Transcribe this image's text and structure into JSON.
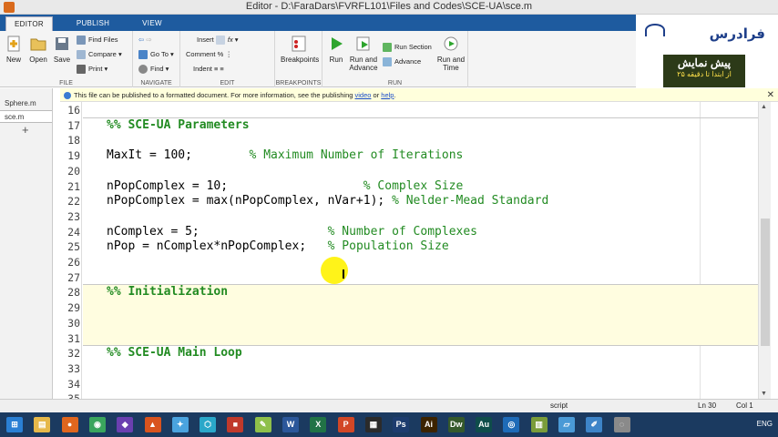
{
  "window": {
    "title": "Editor - D:\\FaraDars\\FVRFL101\\Files and Codes\\SCE-UA\\sce.m"
  },
  "tabs": [
    {
      "label": "EDITOR"
    },
    {
      "label": "PUBLISH"
    },
    {
      "label": "VIEW"
    }
  ],
  "ribbon": {
    "file": {
      "new": "New",
      "open": "Open",
      "save": "Save",
      "find_files": "Find Files",
      "compare": "Compare",
      "print": "Print",
      "group": "FILE"
    },
    "navigate": {
      "go_to": "Go To",
      "find": "Find",
      "group": "NAVIGATE"
    },
    "edit": {
      "insert": "Insert",
      "comment": "Comment",
      "indent": "Indent",
      "fx": "fx",
      "group": "EDIT"
    },
    "breakpoints": {
      "breakpoints": "Breakpoints",
      "group": "BREAKPOINTS"
    },
    "run": {
      "run": "Run",
      "run_advance": "Run and Advance",
      "run_section": "Run Section",
      "advance": "Advance",
      "run_time": "Run and Time",
      "group": "RUN"
    }
  },
  "logo": {
    "brand": "فرادرس",
    "promo_line1": "پیش نمایش",
    "promo_line2": "از ابتدا تا دقیقه ۲۵"
  },
  "infobar": {
    "text": "This file can be published to a formatted document. For more information, see the publishing ",
    "link1": "video",
    "mid": " or ",
    "link2": "help",
    "end": "."
  },
  "files": [
    {
      "label": "Sphere.m"
    },
    {
      "label": "sce.m"
    }
  ],
  "editor": {
    "lines": [
      {
        "n": "16",
        "code": "",
        "comment": ""
      },
      {
        "n": "17",
        "code": "",
        "comment": "%% SCE-UA Parameters",
        "cell": true
      },
      {
        "n": "18",
        "code": "",
        "comment": ""
      },
      {
        "n": "19",
        "code": "MaxIt = 100;        ",
        "comment": "% Maximum Number of Iterations"
      },
      {
        "n": "20",
        "code": "",
        "comment": ""
      },
      {
        "n": "21",
        "code": "nPopComplex = 10;                   ",
        "comment": "% Complex Size"
      },
      {
        "n": "22",
        "code": "nPopComplex = max(nPopComplex, nVar+1); ",
        "comment": "% Nelder-Mead Standard"
      },
      {
        "n": "23",
        "code": "",
        "comment": ""
      },
      {
        "n": "24",
        "code": "nComplex = 5;                  ",
        "comment": "% Number of Complexes"
      },
      {
        "n": "25",
        "code": "nPop = nComplex*nPopComplex;   ",
        "comment": "% Population Size"
      },
      {
        "n": "26",
        "code": "",
        "comment": ""
      },
      {
        "n": "27",
        "code": "",
        "comment": ""
      },
      {
        "n": "28",
        "code": "",
        "comment": "%% Initialization",
        "cell": true
      },
      {
        "n": "29",
        "code": "",
        "comment": ""
      },
      {
        "n": "30",
        "code": "",
        "comment": ""
      },
      {
        "n": "31",
        "code": "",
        "comment": ""
      },
      {
        "n": "32",
        "code": "",
        "comment": "%% SCE-UA Main Loop",
        "cell": true
      },
      {
        "n": "33",
        "code": "",
        "comment": ""
      },
      {
        "n": "34",
        "code": "",
        "comment": ""
      },
      {
        "n": "35",
        "code": "",
        "comment": ""
      }
    ]
  },
  "status": {
    "mode": "script",
    "ln": "Ln  30",
    "col": "Col  1"
  },
  "taskbar": {
    "lang": "ENG",
    "apps": [
      {
        "name": "start",
        "color": "#2a7fd4",
        "glyph": "⊞"
      },
      {
        "name": "explorer",
        "color": "#e6b84a",
        "glyph": "▤"
      },
      {
        "name": "firefox",
        "color": "#e0661e",
        "glyph": "●"
      },
      {
        "name": "chrome",
        "color": "#3aa55d",
        "glyph": "◉"
      },
      {
        "name": "visual-studio",
        "color": "#6a3fb0",
        "glyph": "◆"
      },
      {
        "name": "matlab",
        "color": "#d9531e",
        "glyph": "▲"
      },
      {
        "name": "app",
        "color": "#4aa3df",
        "glyph": "✦"
      },
      {
        "name": "app",
        "color": "#2aa7c9",
        "glyph": "⬡"
      },
      {
        "name": "app",
        "color": "#c0392b",
        "glyph": "■"
      },
      {
        "name": "app",
        "color": "#8fc04a",
        "glyph": "✎"
      },
      {
        "name": "word",
        "color": "#2b579a",
        "glyph": "W"
      },
      {
        "name": "excel",
        "color": "#217346",
        "glyph": "X"
      },
      {
        "name": "powerpoint",
        "color": "#d24726",
        "glyph": "P"
      },
      {
        "name": "app",
        "color": "#2b2b2b",
        "glyph": "▦"
      },
      {
        "name": "photoshop",
        "color": "#1d3c6e",
        "glyph": "Ps"
      },
      {
        "name": "illustrator",
        "color": "#3c2300",
        "glyph": "Ai"
      },
      {
        "name": "dreamweaver",
        "color": "#35592b",
        "glyph": "Dw"
      },
      {
        "name": "audition",
        "color": "#0f4d4a",
        "glyph": "Au"
      },
      {
        "name": "app",
        "color": "#1e6bb8",
        "glyph": "◎"
      },
      {
        "name": "app",
        "color": "#7a9c3a",
        "glyph": "▥"
      },
      {
        "name": "app",
        "color": "#4a9ad6",
        "glyph": "▱"
      },
      {
        "name": "app",
        "color": "#3d84c8",
        "glyph": "✐"
      },
      {
        "name": "app",
        "color": "#8a8a8a",
        "glyph": "◌"
      }
    ]
  }
}
